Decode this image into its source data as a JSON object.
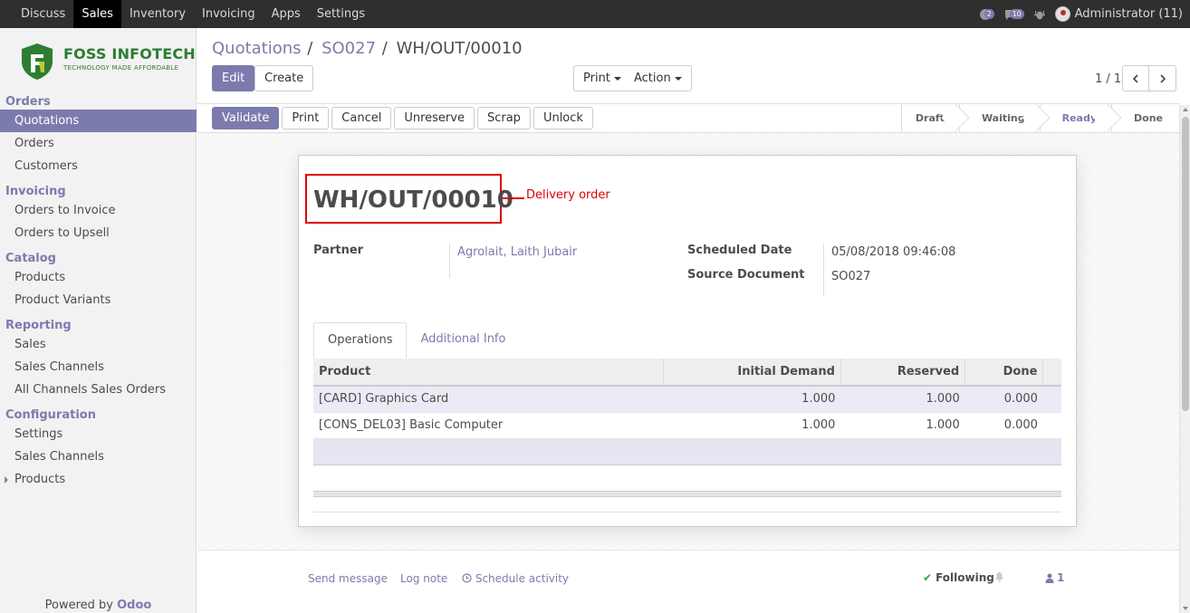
{
  "topbar": {
    "menu": [
      "Discuss",
      "Sales",
      "Inventory",
      "Invoicing",
      "Apps",
      "Settings"
    ],
    "active_menu": "Sales",
    "activity_count": "2",
    "message_count": "10",
    "user": "Administrator (11)"
  },
  "logo": {
    "name": "FOSS INFOTECH",
    "tagline": "TECHNOLOGY MADE AFFORDABLE"
  },
  "sidebar": {
    "sections": [
      {
        "title": "Orders",
        "items": [
          "Quotations",
          "Orders",
          "Customers"
        ]
      },
      {
        "title": "Invoicing",
        "items": [
          "Orders to Invoice",
          "Orders to Upsell"
        ]
      },
      {
        "title": "Catalog",
        "items": [
          "Products",
          "Product Variants"
        ]
      },
      {
        "title": "Reporting",
        "items": [
          "Sales",
          "Sales Channels",
          "All Channels Sales Orders"
        ]
      },
      {
        "title": "Configuration",
        "items": [
          "Settings",
          "Sales Channels",
          "Products"
        ]
      }
    ],
    "active_item": "Quotations",
    "powered_by": "Powered by",
    "powered_brand": "Odoo"
  },
  "breadcrumb": {
    "items": [
      "Quotations",
      "SO027",
      "WH/OUT/00010"
    ]
  },
  "control": {
    "edit": "Edit",
    "create": "Create",
    "print": "Print",
    "action": "Action",
    "pager": "1 / 1"
  },
  "statusbar": {
    "buttons": [
      "Validate",
      "Print",
      "Cancel",
      "Unreserve",
      "Scrap",
      "Unlock"
    ],
    "steps": [
      "Draft",
      "Waiting",
      "Ready",
      "Done"
    ],
    "active_step": "Ready"
  },
  "form": {
    "title": "WH/OUT/00010",
    "annotation": "Delivery order",
    "partner_label": "Partner",
    "partner_value": "Agrolait, Laith Jubair",
    "scheduled_label": "Scheduled Date",
    "scheduled_value": "05/08/2018 09:46:08",
    "source_label": "Source Document",
    "source_value": "SO027",
    "tabs": [
      "Operations",
      "Additional Info"
    ],
    "active_tab": "Operations",
    "columns": [
      "Product",
      "Initial Demand",
      "Reserved",
      "Done"
    ],
    "rows": [
      {
        "product": "[CARD] Graphics Card",
        "initial": "1.000",
        "reserved": "1.000",
        "done": "0.000"
      },
      {
        "product": "[CONS_DEL03] Basic Computer",
        "initial": "1.000",
        "reserved": "1.000",
        "done": "0.000"
      }
    ]
  },
  "chatter": {
    "send_message": "Send message",
    "log_note": "Log note",
    "schedule": "Schedule activity",
    "following": "Following",
    "followers": "1"
  },
  "colors": {
    "accent": "#7c7bad",
    "topbar": "#2f2f2f",
    "annotation": "#dd0000"
  },
  "icons": [
    "bubble-activity-icon",
    "chat-icon",
    "bug-icon",
    "avatar",
    "chevron-left-icon",
    "chevron-right-icon",
    "clock-icon",
    "check-icon",
    "bell-icon",
    "user-icon"
  ]
}
